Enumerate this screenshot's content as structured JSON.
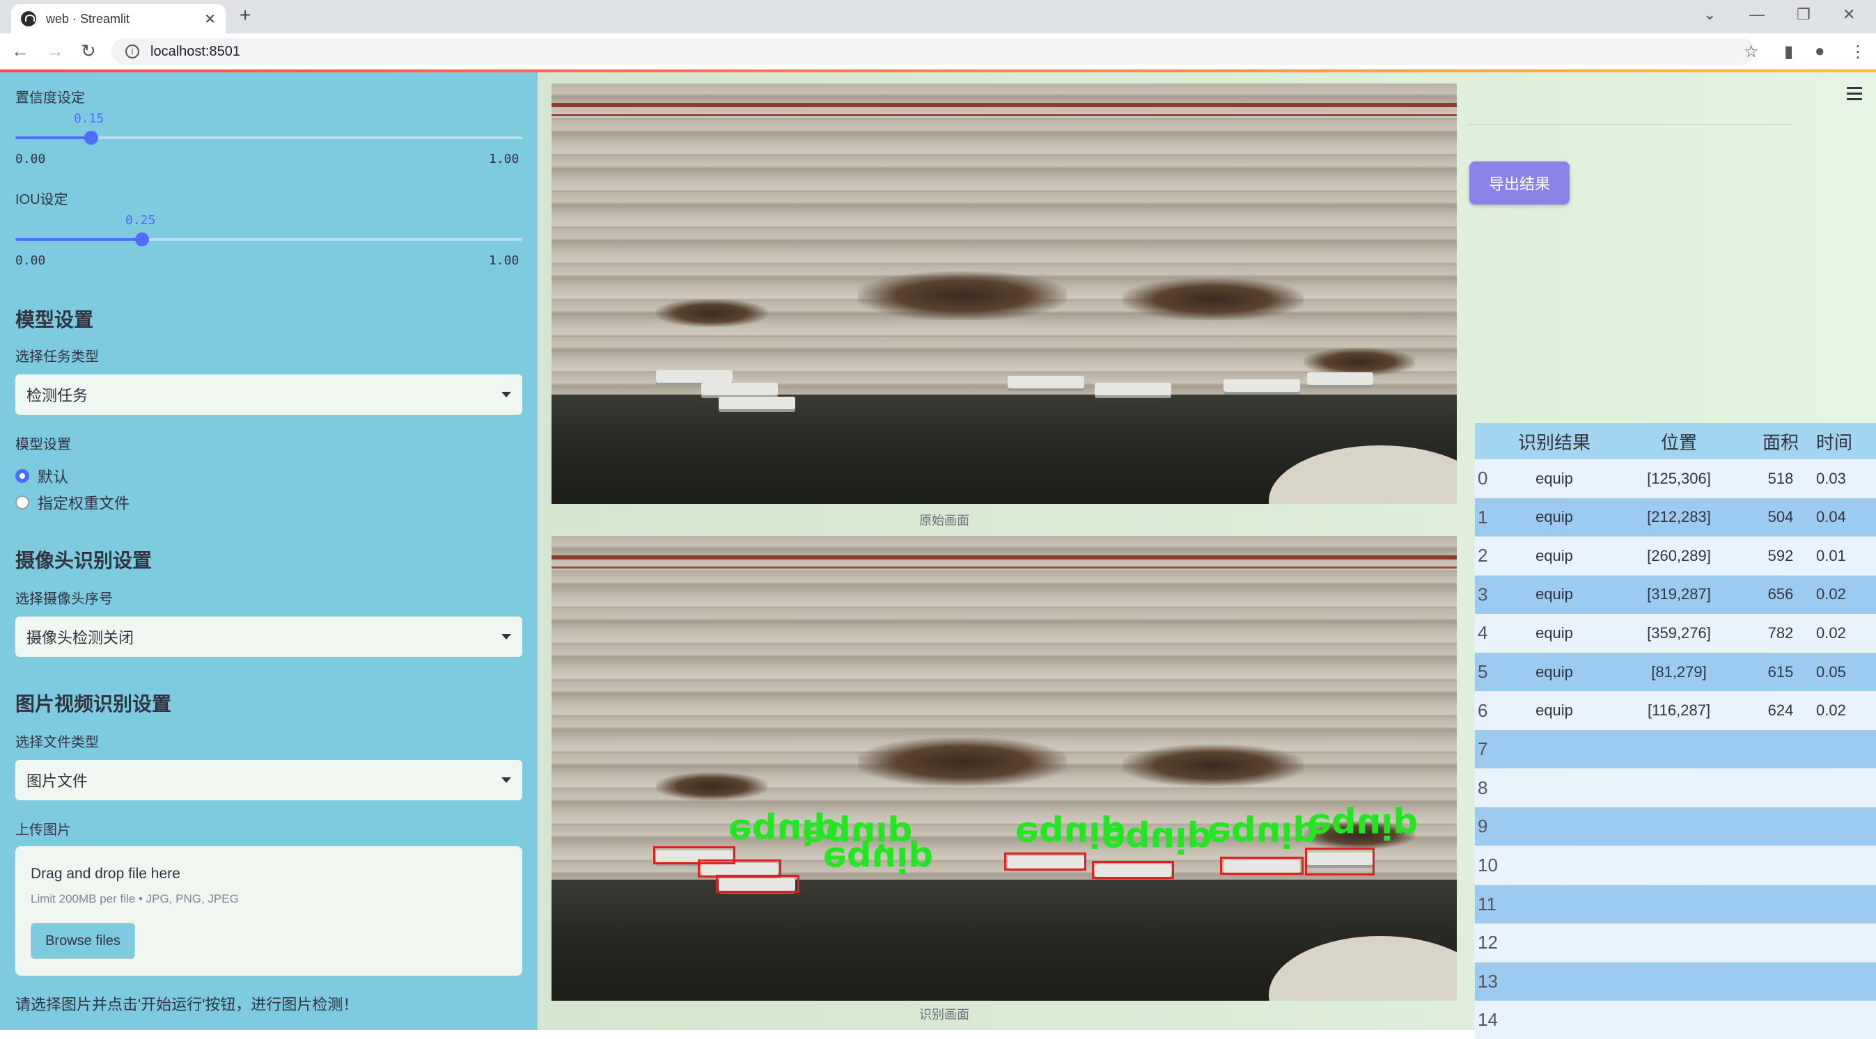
{
  "browser": {
    "tab_title": "web · Streamlit",
    "url": "localhost:8501"
  },
  "sidebar": {
    "confidence": {
      "label": "置信度设定",
      "value": "0.15",
      "min": "0.00",
      "max": "1.00",
      "fraction": 0.15
    },
    "iou": {
      "label": "IOU设定",
      "value": "0.25",
      "min": "0.00",
      "max": "1.00",
      "fraction": 0.25
    },
    "model_section": "模型设置",
    "task_label": "选择任务类型",
    "task_value": "检测任务",
    "model_label": "模型设置",
    "radio_default": "默认",
    "radio_custom": "指定权重文件",
    "camera_section": "摄像头识别设置",
    "camera_label": "选择摄像头序号",
    "camera_value": "摄像头检测关闭",
    "media_section": "图片视频识别设置",
    "file_type_label": "选择文件类型",
    "file_type_value": "图片文件",
    "upload_label": "上传图片",
    "upload_title": "Drag and drop file here",
    "upload_limit": "Limit 200MB per file • JPG, PNG, JPEG",
    "browse_label": "Browse files",
    "hint": "请选择图片并点击'开始运行'按钮，进行图片检测！"
  },
  "main": {
    "original_caption": "原始画面",
    "result_caption": "识别画面",
    "export_label": "导出结果",
    "detection_label": "equip"
  },
  "table": {
    "headers": [
      "",
      "识别结果",
      "位置",
      "面积",
      "时间"
    ],
    "rows": [
      [
        "0",
        "equip",
        "[125,306]",
        "518",
        "0.03"
      ],
      [
        "1",
        "equip",
        "[212,283]",
        "504",
        "0.04"
      ],
      [
        "2",
        "equip",
        "[260,289]",
        "592",
        "0.01"
      ],
      [
        "3",
        "equip",
        "[319,287]",
        "656",
        "0.02"
      ],
      [
        "4",
        "equip",
        "[359,276]",
        "782",
        "0.02"
      ],
      [
        "5",
        "equip",
        "[81,279]",
        "615",
        "0.05"
      ],
      [
        "6",
        "equip",
        "[116,287]",
        "624",
        "0.02"
      ],
      [
        "7",
        "",
        "",
        "",
        ""
      ],
      [
        "8",
        "",
        "",
        "",
        ""
      ],
      [
        "9",
        "",
        "",
        "",
        ""
      ],
      [
        "10",
        "",
        "",
        "",
        ""
      ],
      [
        "11",
        "",
        "",
        "",
        ""
      ],
      [
        "12",
        "",
        "",
        "",
        ""
      ],
      [
        "13",
        "",
        "",
        "",
        ""
      ],
      [
        "14",
        "",
        "",
        "",
        ""
      ]
    ]
  }
}
